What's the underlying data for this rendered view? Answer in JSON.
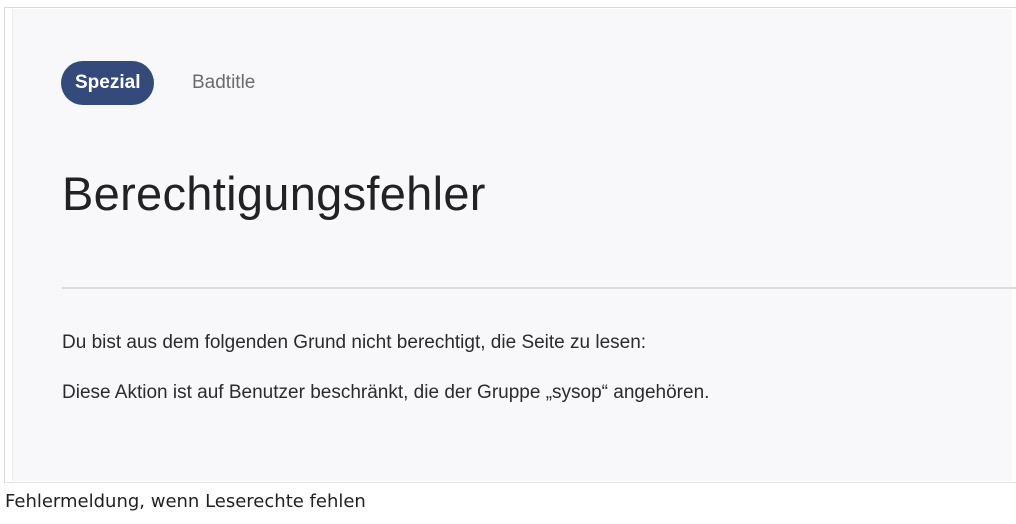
{
  "header": {
    "namespace_badge": "Spezial",
    "breadcrumb": "Badtitle"
  },
  "main": {
    "title": "Berechtigungsfehler",
    "messages": [
      "Du bist aus dem folgenden Grund nicht berechtigt, die Seite zu lesen:",
      "Diese Aktion ist auf Benutzer beschränkt, die der Gruppe „sysop“ angehören."
    ]
  },
  "caption": "Fehlermeldung, wenn Leserechte fehlen",
  "colors": {
    "badge_bg": "#344a7a",
    "panel_bg": "#f8f8fa"
  }
}
